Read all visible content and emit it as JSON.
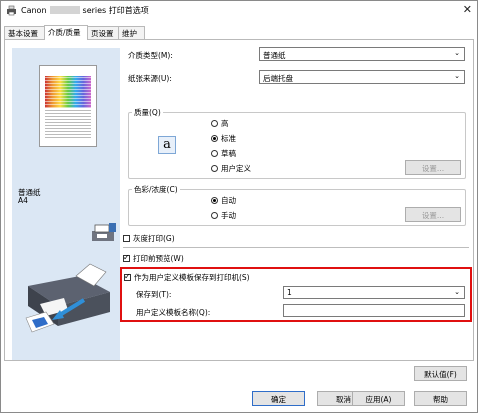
{
  "window": {
    "title_prefix": "Canon",
    "title_suffix": "series 打印首选项",
    "close_symbol": "✕"
  },
  "tabs": [
    {
      "label": "基本设置"
    },
    {
      "label": "介质/质量"
    },
    {
      "label": "页设置"
    },
    {
      "label": "维护"
    }
  ],
  "preview": {
    "media_type": "普通纸",
    "paper_size": "A4"
  },
  "media": {
    "label": "介质类型(M):",
    "value": "普通纸"
  },
  "paper_source": {
    "label": "纸张来源(U):",
    "value": "后端托盘"
  },
  "quality": {
    "legend": "质量(Q)",
    "icon_letter": "a",
    "options": [
      "高",
      "标准",
      "草稿",
      "用户定义"
    ],
    "selected": "标准",
    "set_button": "设置..."
  },
  "color": {
    "legend": "色彩/浓度(C)",
    "options": [
      "自动",
      "手动"
    ],
    "selected": "自动",
    "set_button": "设置..."
  },
  "grayscale": {
    "label": "灰度打印(G)",
    "checked": false
  },
  "print_preview": {
    "label": "打印前预览(W)",
    "checked": true
  },
  "custom_template": {
    "label": "作为用户定义模板保存到打印机(S)",
    "checked": true,
    "save_to_label": "保存到(T):",
    "save_to_value": "1",
    "name_label": "用户定义模板名称(Q):",
    "name_value": ""
  },
  "defaults_button": "默认值(F)",
  "footer": {
    "ok": "确定",
    "cancel": "取消",
    "apply": "应用(A)",
    "help": "帮助"
  },
  "icons": {
    "app": "canon-printer-icon",
    "dropdown": "chevron-down-icon"
  },
  "colors": {
    "left_panel": "#dbe7f4",
    "highlight_border": "#e01010",
    "default_button_border": "#2f6dc8"
  }
}
